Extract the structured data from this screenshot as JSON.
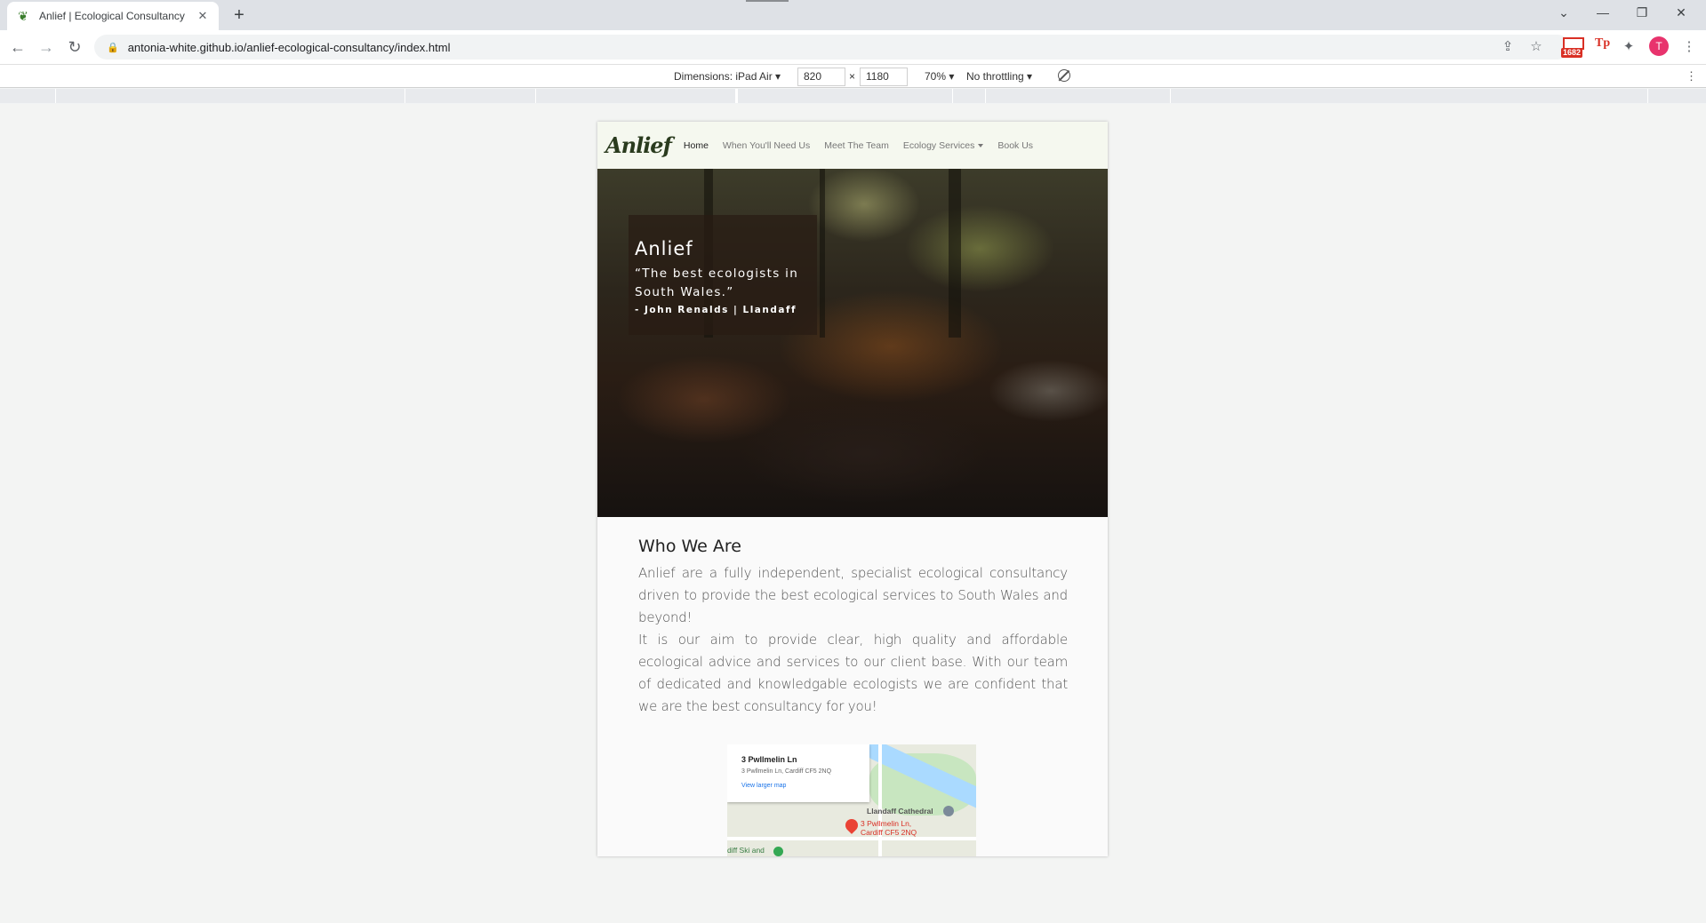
{
  "browser": {
    "tab_title": "Anlief | Ecological Consultancy",
    "url": "antonia-white.github.io/anlief-ecological-consultancy/index.html"
  },
  "device_toolbar": {
    "dimensions_label": "Dimensions: iPad Air",
    "width_value": "820",
    "times": "×",
    "height_value": "1180",
    "zoom": "70%",
    "throttling": "No throttling"
  },
  "extensions": {
    "gmail_badge": "1682",
    "tp_label": "Tp",
    "avatar_letter": "T"
  },
  "site": {
    "brand": "Anlief",
    "nav": [
      {
        "label": "Home"
      },
      {
        "label": "When You'll Need Us"
      },
      {
        "label": "Meet The Team"
      },
      {
        "label": "Ecology Services"
      },
      {
        "label": "Book Us"
      }
    ],
    "hero": {
      "title": "Anlief",
      "quote": "“The best ecologists in South Wales.”",
      "cite": "- John Renalds | Llandaff"
    },
    "about": {
      "heading": "Who We Are",
      "para1": "Anlief are a fully independent, specialist ecological consultancy driven to provide the best ecological services to South Wales and beyond!",
      "para2": "It is our aim to provide clear, high quality and affordable ecological advice and services to our client base. With our team of dedicated and knowledgable ecologists we are confident that we are the best consultancy for you!"
    },
    "map": {
      "place_title": "3 Pwllmelin Ln",
      "place_address": "3 Pwllmelin Ln, Cardiff CF5 2NQ",
      "larger_map": "View larger map",
      "pin_label_1": "3 Pwllmelin Ln,",
      "pin_label_2": "Cardiff CF5 2NQ",
      "poi": "Llandaff Cathedral",
      "ski": "diff Ski and"
    }
  }
}
